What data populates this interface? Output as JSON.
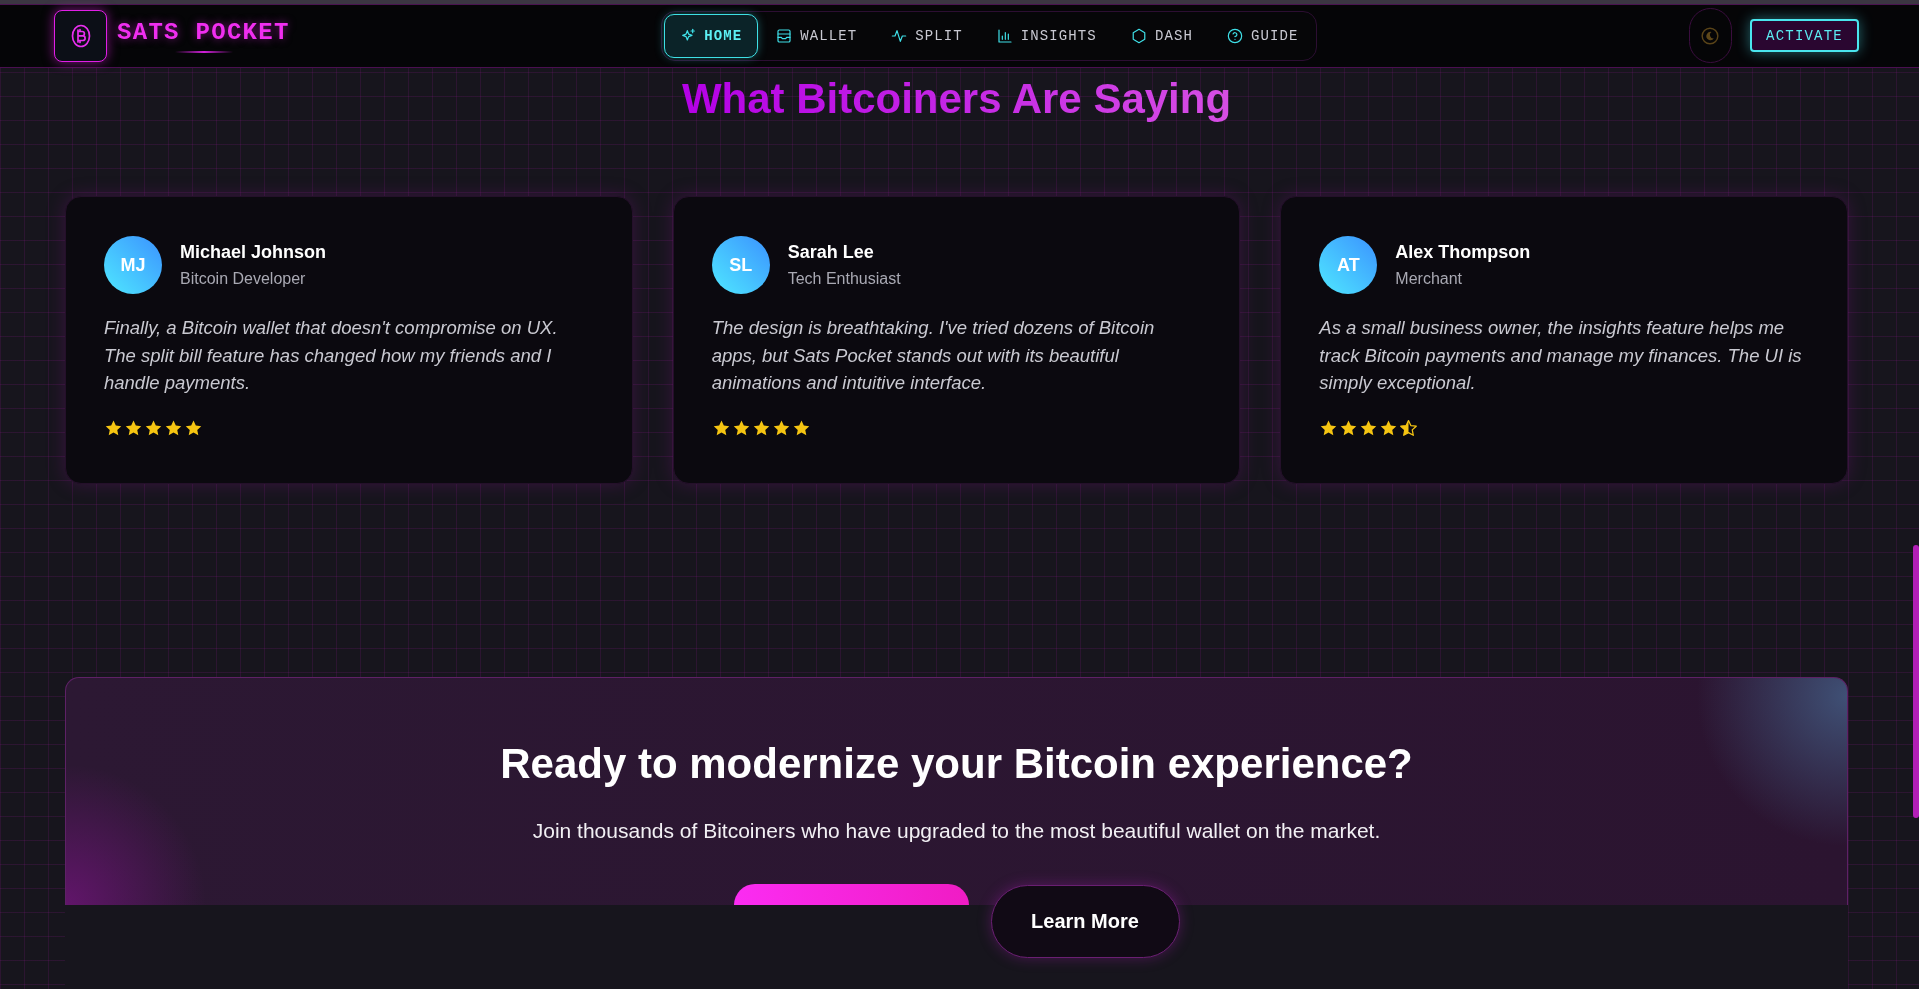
{
  "header": {
    "logo_text": "SATS POCKET",
    "nav": [
      {
        "label": "HOME",
        "selected": true
      },
      {
        "label": "WALLET",
        "selected": false
      },
      {
        "label": "SPLIT",
        "selected": false
      },
      {
        "label": "INSIGHTS",
        "selected": false
      },
      {
        "label": "DASH",
        "selected": false
      },
      {
        "label": "GUIDE",
        "selected": false
      }
    ],
    "activate_button": "ACTIVATE"
  },
  "testimonials": {
    "title": "What Bitcoiners Are Saying",
    "cards": [
      {
        "initials": "MJ",
        "name": "Michael Johnson",
        "role": "Bitcoin Developer",
        "quote": "Finally, a Bitcoin wallet that doesn't compromise on UX. The split bill feature has changed how my friends and I handle payments.",
        "stars": 5
      },
      {
        "initials": "SL",
        "name": "Sarah Lee",
        "role": "Tech Enthusiast",
        "quote": "The design is breathtaking. I've tried dozens of Bitcoin apps, but Sats Pocket stands out with its beautiful animations and intuitive interface.",
        "stars": 5
      },
      {
        "initials": "AT",
        "name": "Alex Thompson",
        "role": "Merchant",
        "quote": "As a small business owner, the insights feature helps me track Bitcoin payments and manage my finances. The UI is simply exceptional.",
        "stars": 4.5
      }
    ]
  },
  "cta": {
    "heading": "Ready to modernize your Bitcoin experience?",
    "text": "Join thousands of Bitcoiners who have upgraded to the most beautiful wallet on the market.",
    "secondary_button": "Learn More"
  }
}
